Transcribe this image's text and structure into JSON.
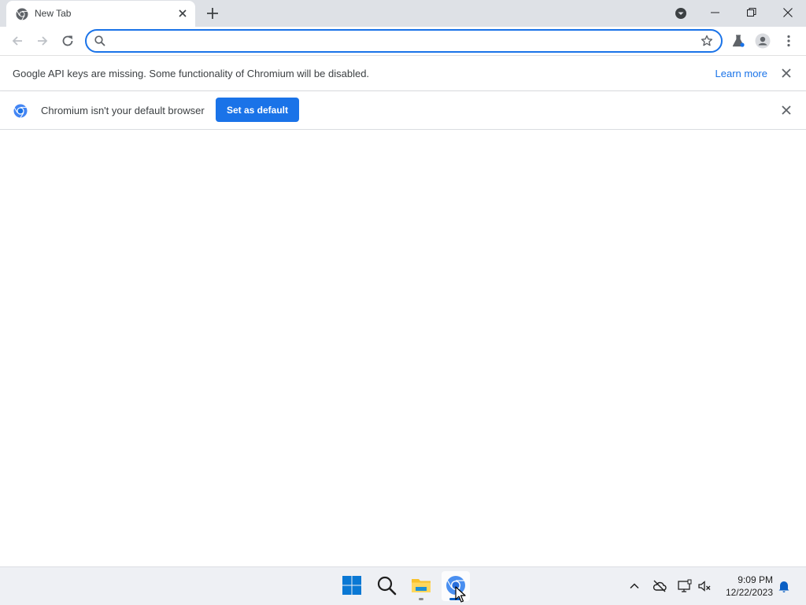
{
  "tab": {
    "title": "New Tab",
    "favicon": "chromium-icon"
  },
  "window_controls": [
    "minimize-icon",
    "restore-icon",
    "close-icon"
  ],
  "toolbar": {
    "back_icon": "back-arrow-icon",
    "forward_icon": "forward-arrow-icon",
    "reload_icon": "reload-icon",
    "omnibox": {
      "value": "",
      "placeholder": ""
    },
    "extensions_icon": "labs-flask-icon",
    "profile_icon": "profile-avatar-icon",
    "menu_icon": "kebab-menu-icon"
  },
  "infobar_api": {
    "message": "Google API keys are missing. Some functionality of Chromium will be disabled.",
    "link": "Learn more"
  },
  "infobar_default": {
    "message": "Chromium isn't your default browser",
    "button": "Set as default"
  },
  "taskbar": {
    "apps": [
      "start-icon",
      "search-icon",
      "file-explorer-icon",
      "chromium-icon"
    ],
    "tray": [
      "chevron-up-icon",
      "onedrive-icon",
      "display-icon",
      "volume-muted-icon",
      "notification-bell-icon"
    ],
    "time": "9:09 PM",
    "date": "12/22/2023"
  },
  "colors": {
    "accent": "#1a73e8",
    "tabstrip": "#dee1e6",
    "taskbar": "#eef0f4"
  }
}
